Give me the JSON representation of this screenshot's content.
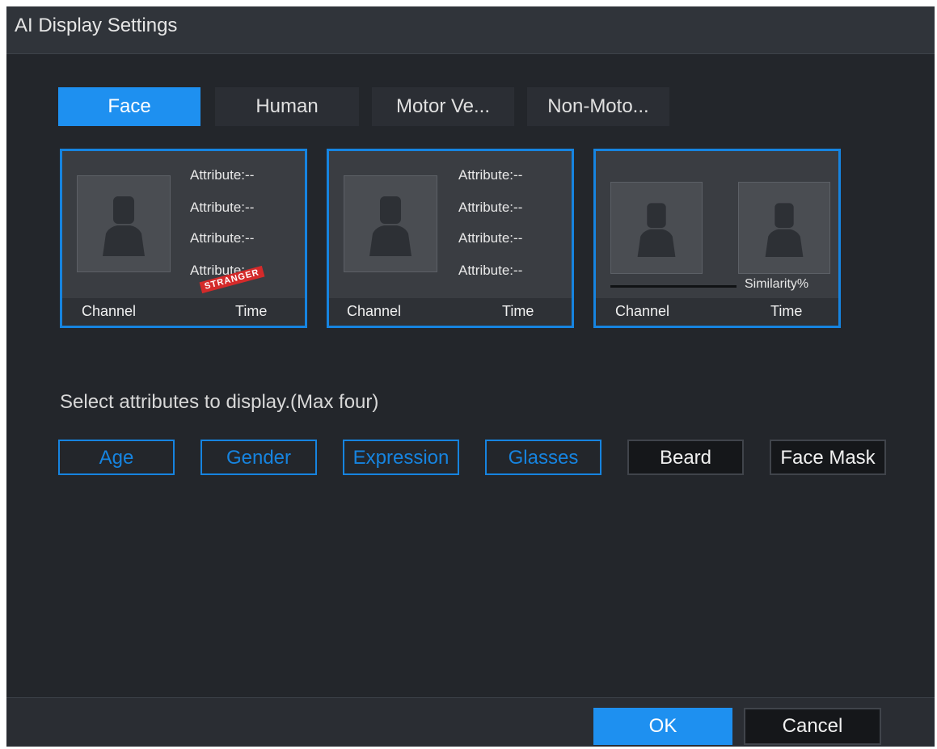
{
  "window": {
    "title": "AI Display Settings"
  },
  "tabs": [
    {
      "label": "Face",
      "active": true
    },
    {
      "label": "Human",
      "active": false
    },
    {
      "label": "Motor Ve...",
      "active": false
    },
    {
      "label": "Non-Moto...",
      "active": false
    }
  ],
  "cards": [
    {
      "attributes": [
        "Attribute:--",
        "Attribute:--",
        "Attribute:--",
        "Attribute:--"
      ],
      "badge": "STRANGER",
      "footer_left": "Channel",
      "footer_right": "Time"
    },
    {
      "attributes": [
        "Attribute:--",
        "Attribute:--",
        "Attribute:--",
        "Attribute:--"
      ],
      "footer_left": "Channel",
      "footer_right": "Time"
    },
    {
      "similarity_label": "Similarity%",
      "footer_left": "Channel",
      "footer_right": "Time"
    }
  ],
  "prompt": "Select attributes to display.(Max four)",
  "attribute_chips": [
    {
      "label": "Age",
      "selected": true
    },
    {
      "label": "Gender",
      "selected": true
    },
    {
      "label": "Expression",
      "selected": true
    },
    {
      "label": "Glasses",
      "selected": true
    },
    {
      "label": "Beard",
      "selected": false
    },
    {
      "label": "Face Mask",
      "selected": false
    }
  ],
  "buttons": {
    "ok": "OK",
    "cancel": "Cancel"
  },
  "colors": {
    "accent": "#1e90f0",
    "background": "#23262b",
    "badge": "#d42a2a"
  }
}
